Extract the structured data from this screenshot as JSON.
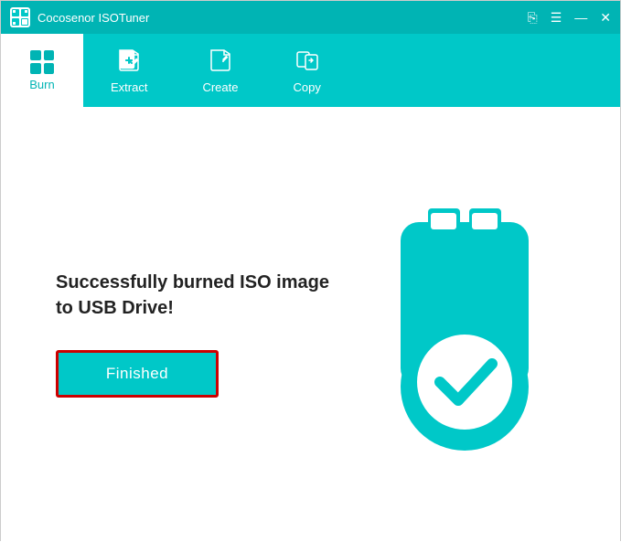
{
  "app": {
    "title": "Cocosenor ISOTuner"
  },
  "titlebar": {
    "share_icon": "⎘",
    "menu_icon": "☰",
    "minimize_icon": "—",
    "close_icon": "✕"
  },
  "toolbar": {
    "items": [
      {
        "id": "burn",
        "label": "Burn",
        "active": true
      },
      {
        "id": "extract",
        "label": "Extract",
        "active": false
      },
      {
        "id": "create",
        "label": "Create",
        "active": false
      },
      {
        "id": "copy",
        "label": "Copy",
        "active": false
      }
    ]
  },
  "content": {
    "success_message_line1": "Successfully burned ISO image",
    "success_message_line2": "to USB Drive!",
    "finished_button_label": "Finished"
  },
  "colors": {
    "teal": "#00c8c8",
    "teal_dark": "#00b4b4",
    "red_border": "#cc0000",
    "white": "#ffffff"
  }
}
